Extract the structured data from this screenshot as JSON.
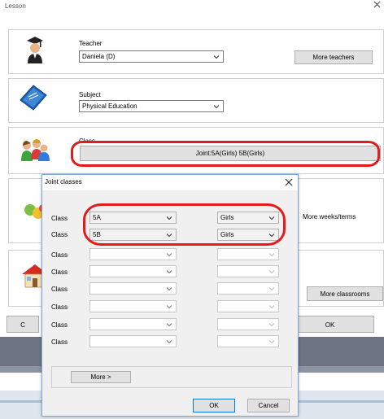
{
  "window": {
    "title": "Lesson"
  },
  "teacher": {
    "label": "Teacher",
    "value": "Daniela (D)",
    "more_label": "More teachers"
  },
  "subject": {
    "label": "Subject",
    "value": "Physical Education"
  },
  "class_group": {
    "label": "Class",
    "value": "Joint:5A(Girls) 5B(Girls)"
  },
  "weeks": {
    "more_label": "More weeks/terms"
  },
  "classroom": {
    "more_label": "More classrooms"
  },
  "main_ok_label": "OK",
  "main_cancel_partial": "C",
  "dialog": {
    "title": "Joint classes",
    "rows": [
      {
        "label": "Class",
        "class_value": "5A",
        "group_value": "Girls"
      },
      {
        "label": "Class",
        "class_value": "5B",
        "group_value": "Girls"
      },
      {
        "label": "Class",
        "class_value": "",
        "group_value": ""
      },
      {
        "label": "Class",
        "class_value": "",
        "group_value": ""
      },
      {
        "label": "Class",
        "class_value": "",
        "group_value": ""
      },
      {
        "label": "Class",
        "class_value": "",
        "group_value": ""
      },
      {
        "label": "Class",
        "class_value": "",
        "group_value": ""
      },
      {
        "label": "Class",
        "class_value": "",
        "group_value": ""
      }
    ],
    "more_label": "More >",
    "ok_label": "OK",
    "cancel_label": "Cancel"
  },
  "colors": {
    "highlight": "#e51b1b",
    "taskbar_dark": "#6e7383",
    "taskbar_light": "#dfe6ee",
    "dialog_border": "#7aa7d9"
  },
  "icons": [
    "teacher-icon",
    "subject-book-icon",
    "class-students-icon",
    "weeks-icon",
    "classroom-house-icon",
    "close-icon",
    "chevron-down-icon"
  ]
}
